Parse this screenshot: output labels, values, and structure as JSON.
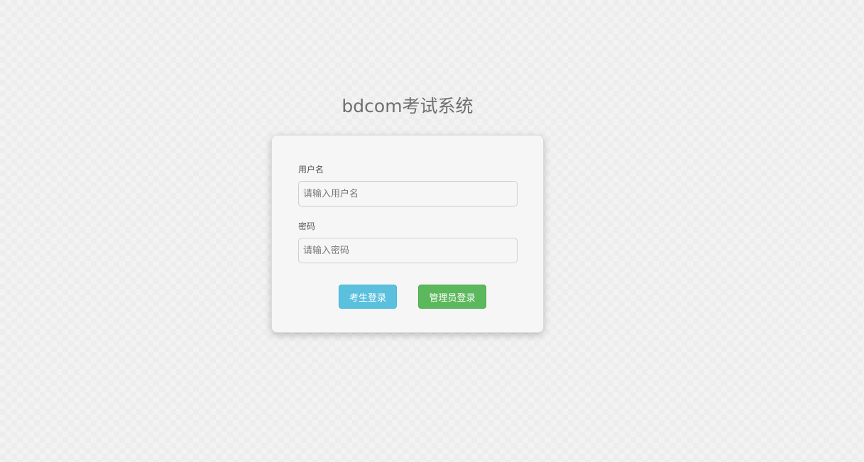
{
  "header": {
    "title": "bdcom考试系统"
  },
  "login_form": {
    "username": {
      "label": "用户名",
      "placeholder": "请输入用户名",
      "value": ""
    },
    "password": {
      "label": "密码",
      "placeholder": "请输入密码",
      "value": ""
    },
    "buttons": {
      "student_login": "考生登录",
      "admin_login": "管理员登录"
    }
  },
  "colors": {
    "student_button": "#5bc0de",
    "admin_button": "#5cb85c",
    "card_background": "#f6f6f6",
    "page_background": "#ededed"
  }
}
